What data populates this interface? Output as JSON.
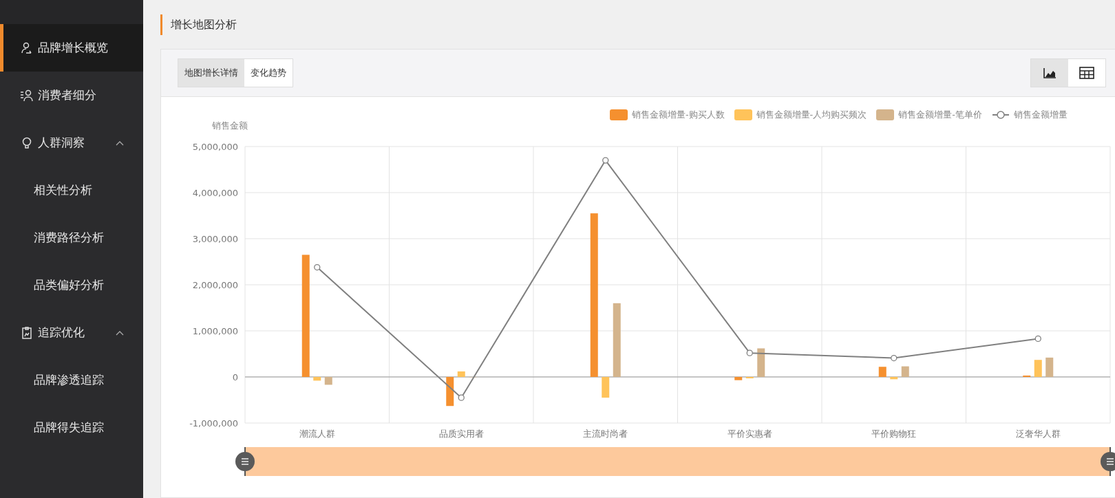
{
  "sidebar": {
    "items": [
      {
        "label": "品牌增长概览",
        "selected": true
      },
      {
        "label": "消费者细分",
        "selected": false
      },
      {
        "label": "人群洞察",
        "selected": false,
        "expanded": true,
        "children": [
          {
            "label": "相关性分析",
            "selected": false
          },
          {
            "label": "消费路径分析",
            "selected": false
          },
          {
            "label": "品类偏好分析",
            "selected": false
          }
        ]
      },
      {
        "label": "追踪优化",
        "selected": false,
        "expanded": true,
        "children": [
          {
            "label": "品牌渗透追踪",
            "selected": false
          },
          {
            "label": "品牌得失追踪",
            "selected": false
          }
        ]
      }
    ]
  },
  "page_title": "增长地图分析",
  "tabs": [
    {
      "label": "地图增长详情",
      "selected": true
    },
    {
      "label": "变化趋势",
      "selected": false
    }
  ],
  "view_toggle": [
    {
      "kind": "chart",
      "selected": true
    },
    {
      "kind": "table",
      "selected": false
    }
  ],
  "chart_data": {
    "type": "bar",
    "stacked": false,
    "grid": true,
    "legend": "top-right",
    "ylabel": "销售金额",
    "categories": [
      "潮流人群",
      "品质实用者",
      "主流时尚者",
      "平价实惠者",
      "平价购物狂",
      "泛奢华人群"
    ],
    "ylim": [
      -1000000,
      5000000
    ],
    "yticks": [
      {
        "value": -1000000,
        "label": "-1,000,000"
      },
      {
        "value": 0,
        "label": "0"
      },
      {
        "value": 1000000,
        "label": "1,000,000"
      },
      {
        "value": 2000000,
        "label": "2,000,000"
      },
      {
        "value": 3000000,
        "label": "3,000,000"
      },
      {
        "value": 4000000,
        "label": "4,000,000"
      },
      {
        "value": 5000000,
        "label": "5,000,000"
      }
    ],
    "series": [
      {
        "name": "销售金额增量-购买人数",
        "color": "#f5902f",
        "type": "bar",
        "values": [
          2650000,
          -630000,
          3550000,
          -70000,
          220000,
          30000
        ]
      },
      {
        "name": "销售金额增量-人均购买频次",
        "color": "#ffc35a",
        "type": "bar",
        "values": [
          -80000,
          120000,
          -450000,
          -30000,
          -50000,
          370000
        ]
      },
      {
        "name": "销售金额增量-笔单价",
        "color": "#d4b48c",
        "type": "bar",
        "values": [
          -170000,
          0,
          1600000,
          620000,
          230000,
          420000
        ]
      },
      {
        "name": "销售金额增量",
        "color": "#808080",
        "type": "line",
        "marker": "circle",
        "values": [
          2380000,
          -450000,
          4700000,
          520000,
          410000,
          830000
        ]
      }
    ]
  }
}
